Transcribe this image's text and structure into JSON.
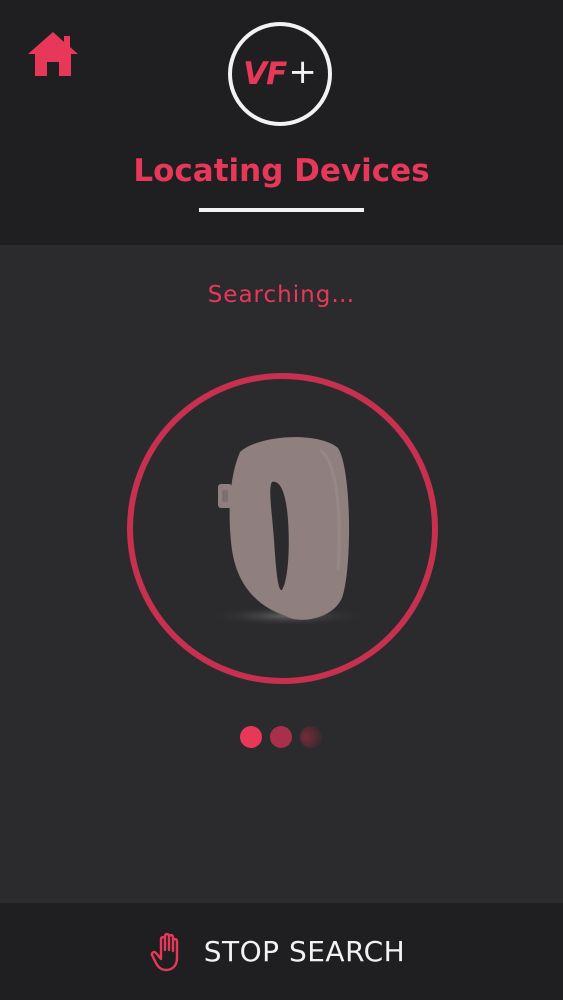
{
  "header": {
    "logo_text": "VF",
    "logo_plus": "+",
    "title": "Locating Devices"
  },
  "main": {
    "status_text": "Searching…"
  },
  "footer": {
    "stop_label": "STOP SEARCH"
  },
  "icons": {
    "home": "home-icon",
    "stop": "hand-stop-icon",
    "device": "fitness-band-icon"
  },
  "colors": {
    "accent": "#e8385a",
    "ring": "#c8304f",
    "header_bg": "#1f1f21",
    "main_bg": "#2b2b2d",
    "device": "#8f7f7f"
  }
}
